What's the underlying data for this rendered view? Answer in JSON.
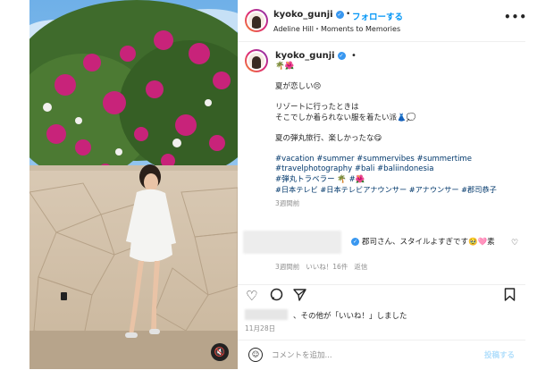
{
  "header": {
    "username": "kyoko_gunji",
    "follow_label": "フォローする",
    "separator": "•",
    "subtitle": "Adeline Hill・Moments to Memories",
    "more_label": "•••"
  },
  "caption": {
    "username": "kyoko_gunji",
    "dot": "•",
    "emoji_line": "🌴🌺",
    "lines": [
      "夏が恋しい😣",
      "",
      "リゾートに行ったときは",
      "そこでしか着られない服を着たい派👗💭",
      "",
      "夏の弾丸旅行、楽しかったな😋",
      ""
    ],
    "hashtag_lines": [
      "#vacation #summer #summervibes #summertime",
      "#travelphotography #bali #baliindonesia",
      "#弾丸トラベラー 🌴 #🌺",
      "#日本テレビ #日本テレビアナウンサー #アナウンサー #郡司恭子"
    ],
    "time": "3週間前"
  },
  "comment": {
    "text": "郡司さん、スタイルよすぎです🥹🩷素",
    "time": "3週間前",
    "likes": "いいね！16件",
    "reply": "返信"
  },
  "likes_text": "、その他が「いいね！」しました",
  "date": "11月28日",
  "comment_input": {
    "placeholder": "コメントを追加...",
    "post_label": "投稿する"
  },
  "icons": [
    "heart-icon",
    "comment-icon",
    "share-icon",
    "bookmark-icon",
    "emoji-icon",
    "sound-off-icon",
    "verified-icon"
  ]
}
